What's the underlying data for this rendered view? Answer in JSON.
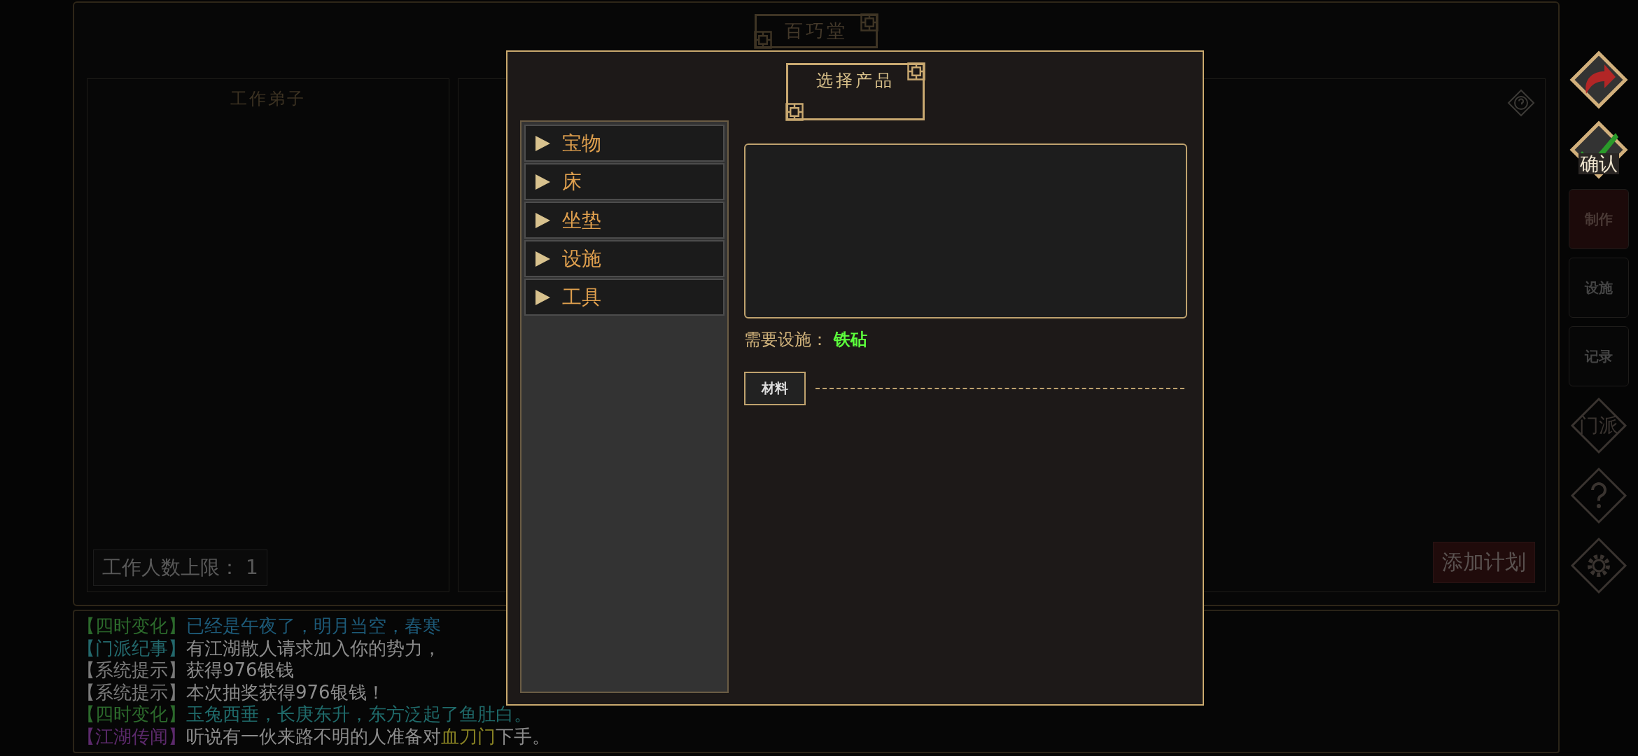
{
  "background": {
    "title": "百巧堂",
    "workers_heading": "工作弟子",
    "worker_limit": "工作人数上限：  1",
    "add_plan_button": "添加计划"
  },
  "log": [
    {
      "segments": [
        {
          "text": "【四时变化】",
          "color": "#2c6a2c"
        },
        {
          "text": "已经是午夜了，明月当空，春寒",
          "color": "#1d5a78"
        }
      ]
    },
    {
      "segments": [
        {
          "text": "【门派纪事】",
          "color": "#23686c"
        },
        {
          "text": "有江湖散人请求加入你的势力，",
          "color": "#8c8c8c"
        }
      ]
    },
    {
      "segments": [
        {
          "text": "【系统提示】",
          "color": "#7a7a7a"
        },
        {
          "text": "获得976银钱",
          "color": "#8c8c8c"
        }
      ]
    },
    {
      "segments": [
        {
          "text": "【系统提示】",
          "color": "#7a7a7a"
        },
        {
          "text": "本次抽奖获得976银钱！",
          "color": "#8c8c8c"
        }
      ]
    },
    {
      "segments": [
        {
          "text": "【四时变化】",
          "color": "#2c6a2c"
        },
        {
          "text": "玉兔西垂，长庚东升，东方泛起了鱼肚白。",
          "color": "#1f6a6a"
        }
      ]
    },
    {
      "segments": [
        {
          "text": "【江湖传闻】",
          "color": "#5c2a6c"
        },
        {
          "text": "听说有一伙来路不明的人准备对",
          "color": "#8c8c8c"
        },
        {
          "text": "血刀门",
          "color": "#8a8424"
        },
        {
          "text": "下手。",
          "color": "#8c8c8c"
        }
      ]
    }
  ],
  "sidebar": [
    {
      "kind": "back"
    },
    {
      "kind": "confirm",
      "label": "确认"
    },
    {
      "kind": "tab",
      "label": "制作",
      "selected": true
    },
    {
      "kind": "tab",
      "label": "设施",
      "selected": false
    },
    {
      "kind": "tab",
      "label": "记录",
      "selected": false
    },
    {
      "kind": "faction",
      "label": "门派"
    },
    {
      "kind": "help"
    },
    {
      "kind": "settings"
    }
  ],
  "dialog": {
    "title": "选择产品",
    "categories": [
      {
        "label": "宝物",
        "expanded": false
      },
      {
        "label": "床",
        "expanded": false
      },
      {
        "label": "坐垫",
        "expanded": false
      },
      {
        "label": "设施",
        "expanded": false
      },
      {
        "label": "工具",
        "expanded": false
      }
    ],
    "requirement": {
      "label": "需要设施：",
      "value": "铁砧"
    },
    "materials_tab": "材料"
  }
}
